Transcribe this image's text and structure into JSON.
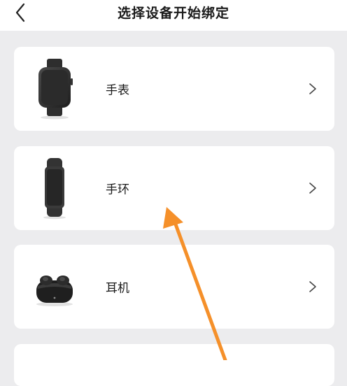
{
  "header": {
    "title": "选择设备开始绑定"
  },
  "devices": [
    {
      "label": "手表",
      "icon": "smartwatch-icon"
    },
    {
      "label": "手环",
      "icon": "fitness-band-icon"
    },
    {
      "label": "耳机",
      "icon": "earbuds-case-icon"
    },
    {
      "label": "",
      "icon": ""
    }
  ],
  "colors": {
    "background": "#ececee",
    "card": "#ffffff",
    "annotation_arrow": "#f5902a"
  }
}
